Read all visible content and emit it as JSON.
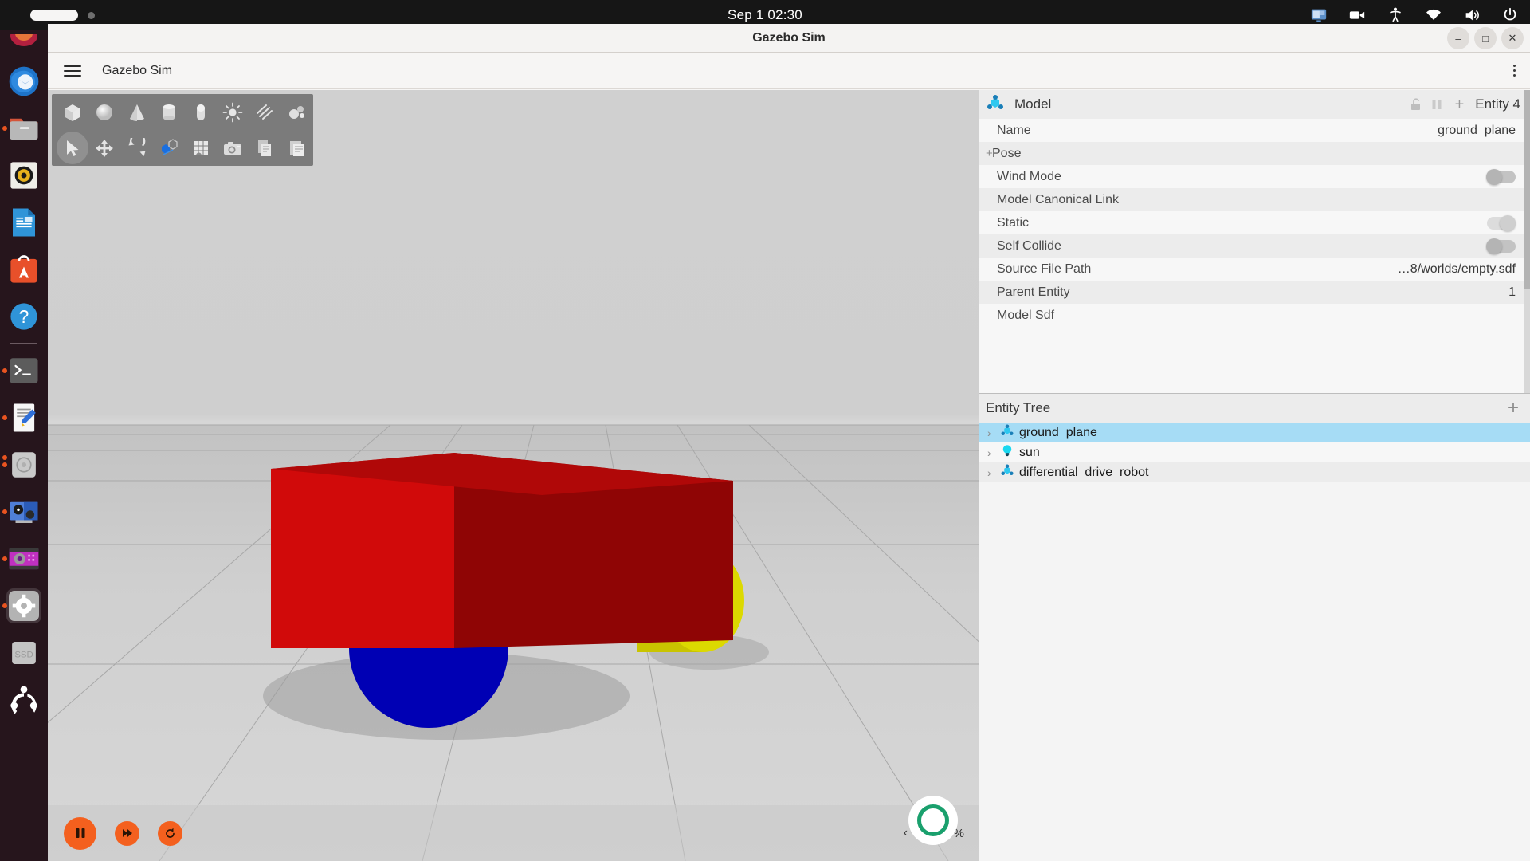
{
  "topbar": {
    "clock": "Sep 1  02:30",
    "tray_icons": [
      "screen-share-icon",
      "camera-icon",
      "accessibility-icon",
      "wifi-icon",
      "volume-icon",
      "power-icon"
    ],
    "activities_label": ""
  },
  "dock": {
    "items": [
      {
        "name": "thunderbird-mail",
        "dots": 0
      },
      {
        "name": "files-nautilus",
        "dots": 1
      },
      {
        "name": "rhythmbox-music",
        "dots": 0
      },
      {
        "name": "libreoffice-writer",
        "dots": 0
      },
      {
        "name": "ubuntu-software",
        "dots": 0
      },
      {
        "name": "help-center",
        "dots": 0
      },
      {
        "name": "terminal",
        "dots": 1
      },
      {
        "name": "text-editor",
        "dots": 1
      },
      {
        "name": "disk-image-mounter",
        "dots": 2
      },
      {
        "name": "media-player",
        "dots": 1
      },
      {
        "name": "video-editor",
        "dots": 1
      },
      {
        "name": "settings",
        "dots": 1
      },
      {
        "name": "ssd-drive",
        "dots": 0
      },
      {
        "name": "show-applications",
        "dots": 0
      }
    ]
  },
  "window": {
    "title": "Gazebo Sim",
    "app_name": "Gazebo Sim",
    "minimize_label": "–",
    "maximize_label": "□",
    "close_label": "✕"
  },
  "viewport": {
    "toolbar_row1": [
      "box-shape-icon",
      "sphere-shape-icon",
      "cone-shape-icon",
      "cylinder-shape-icon",
      "capsule-shape-icon",
      "light-bulb-icon",
      "ellipsoid-icon",
      "material-icon"
    ],
    "toolbar_row2": [
      "select-arrow-icon",
      "translate-icon",
      "rotate-icon",
      "scale-snap-icon",
      "grid-icon",
      "screenshot-camera-icon",
      "copy-icon",
      "paste-icon"
    ],
    "selected_tool": "select-arrow-icon",
    "play_controls": [
      {
        "name": "pause-button",
        "glyph": "▐▌"
      },
      {
        "name": "step-button",
        "glyph": "▶▶"
      },
      {
        "name": "reset-button",
        "glyph": "↻"
      }
    ],
    "zoom_level": "98.32 %",
    "collapse_glyph": "‹"
  },
  "model_panel": {
    "header_title": "Model",
    "header_icon": "model-node-icon",
    "lock_icon": "unlock-icon",
    "pause_icon": "pause-icon",
    "plus_icon": "plus-icon",
    "entity_label": "Entity 4",
    "properties": [
      {
        "name": "Name",
        "value": "ground_plane",
        "type": "text",
        "expandable": false
      },
      {
        "name": "Pose",
        "value": "",
        "type": "group",
        "expandable": true
      },
      {
        "name": "Wind Mode",
        "value": "off",
        "type": "toggle",
        "expandable": false
      },
      {
        "name": "Model Canonical Link",
        "value": "",
        "type": "text",
        "expandable": false
      },
      {
        "name": "Static",
        "value": "on",
        "type": "toggle",
        "expandable": false
      },
      {
        "name": "Self Collide",
        "value": "off",
        "type": "toggle",
        "expandable": false
      },
      {
        "name": "Source File Path",
        "value": "…8/worlds/empty.sdf",
        "type": "text",
        "expandable": false
      },
      {
        "name": "Parent Entity",
        "value": "1",
        "type": "text",
        "expandable": false
      },
      {
        "name": "Model Sdf",
        "value": "",
        "type": "text",
        "expandable": false
      }
    ]
  },
  "entity_tree": {
    "title": "Entity Tree",
    "add_label": "+",
    "items": [
      {
        "label": "ground_plane",
        "icon": "model-node-icon",
        "selected": true,
        "arrow": "›"
      },
      {
        "label": "sun",
        "icon": "light-bulb-icon",
        "selected": false,
        "arrow": "›"
      },
      {
        "label": "differential_drive_robot",
        "icon": "model-node-icon",
        "selected": false,
        "arrow": "›"
      }
    ]
  },
  "scene": {
    "objects": [
      {
        "name": "chassis-box",
        "color": "#cc0000"
      },
      {
        "name": "left-wheel-sphere",
        "color": "#0000b4"
      },
      {
        "name": "right-wheel-cylinder",
        "color": "#d6d400"
      }
    ],
    "ground_color": "#cfcfcf",
    "grid_color": "#a9a9a9"
  },
  "colors": {
    "accent_orange": "#f4601e",
    "selection_blue": "#a6dcf5",
    "panel_bg": "#f4f4f4"
  }
}
